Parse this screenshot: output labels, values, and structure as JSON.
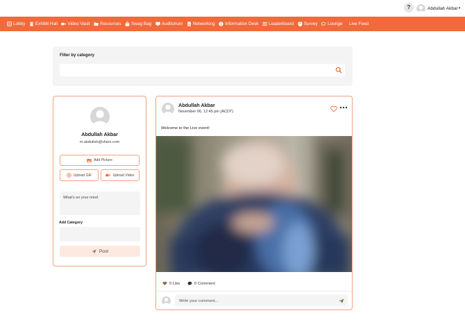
{
  "topbar": {
    "help_label": "?",
    "user_name": "Abdullah Akbar",
    "caret": "▾"
  },
  "nav": {
    "items": [
      {
        "label": "Lobby",
        "icon": "lobby-icon"
      },
      {
        "label": "Exhibit Hall",
        "icon": "building-icon"
      },
      {
        "label": "Video Vault",
        "icon": "video-camera-icon"
      },
      {
        "label": "Resources",
        "icon": "folder-icon"
      },
      {
        "label": "Swag Bag",
        "icon": "bag-icon"
      },
      {
        "label": "Auditorium",
        "icon": "monitor-icon"
      },
      {
        "label": "Networking",
        "icon": "document-icon"
      },
      {
        "label": "Information Desk",
        "icon": "info-icon"
      },
      {
        "label": "Leaderboard",
        "icon": "list-icon"
      },
      {
        "label": "Survey",
        "icon": "survey-icon"
      },
      {
        "label": "Lounge",
        "icon": "chat-icon"
      },
      {
        "label": "Live Feed",
        "icon": ""
      }
    ]
  },
  "filter": {
    "title": "Filter by category",
    "placeholder": ""
  },
  "composer": {
    "name": "Abdullah Akbar",
    "email": "m.abdullah@vfairs.com",
    "add_picture": "Add Picture",
    "upload_gif": "Upload GIF",
    "upload_video": "Upload Video",
    "mind_placeholder": "What's on your mind",
    "category_label": "Add Category",
    "post_label": "Post"
  },
  "post": {
    "author": "Abdullah Akbar",
    "timestamp": "November 06, 12:45 pm (ACDT)",
    "body": "Welcome to the Live event!",
    "like_count_label": "0 Like",
    "comment_count_label": "0 Comment",
    "comment_placeholder": "Write your comment..."
  },
  "colors": {
    "accent": "#f26a3a",
    "accent_border": "#f2a07e",
    "panel_bg": "#f4f4f4",
    "post_button_bg": "#fde9e0"
  }
}
